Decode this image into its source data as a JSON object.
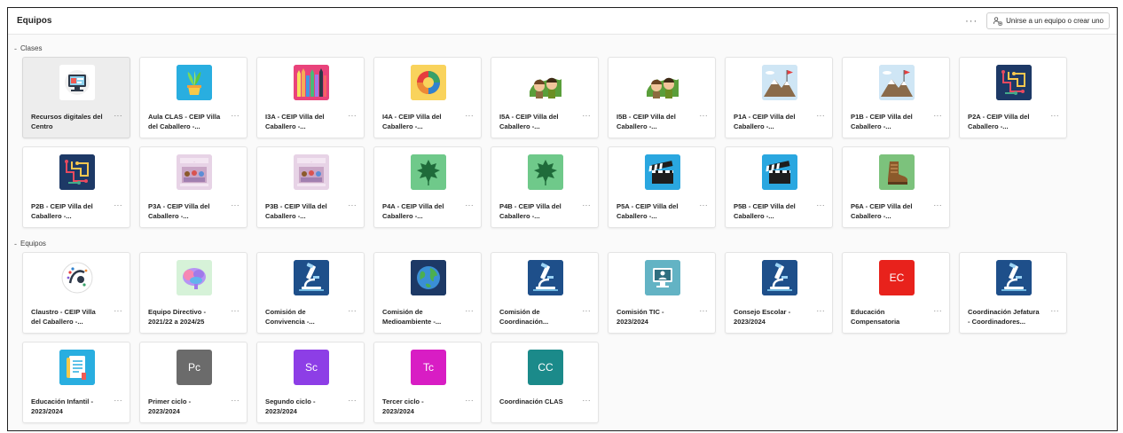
{
  "header": {
    "title": "Equipos",
    "more_label": "···",
    "join_button_label": "Unirse a un equipo o crear uno",
    "join_icon": "people-add-icon"
  },
  "sections": [
    {
      "title": "Clases",
      "caret": "-",
      "teams": [
        {
          "name_line1": "Recursos digitales del",
          "name_line2": "Centro",
          "more": "···",
          "icon": "computer-screen-icon",
          "bg": "#ffffff",
          "selected": true
        },
        {
          "name_line1": "Aula CLAS - CEIP Villa",
          "name_line2": "del Caballero -...",
          "more": "···",
          "icon": "potted-plant-icon",
          "bg": "#29aee0"
        },
        {
          "name_line1": "I3A - CEIP Villa del",
          "name_line2": "Caballero -...",
          "more": "···",
          "icon": "colored-pencils-icon",
          "bg": "#e9437b"
        },
        {
          "name_line1": "I4A - CEIP Villa del",
          "name_line2": "Caballero -...",
          "more": "···",
          "icon": "color-wheel-icon",
          "bg": "#f9d35c"
        },
        {
          "name_line1": "I5A - CEIP Villa del",
          "name_line2": "Caballero -...",
          "more": "···",
          "icon": "jungle-kids-icon",
          "bg": "#ffffff"
        },
        {
          "name_line1": "I5B - CEIP Villa del",
          "name_line2": "Caballero -...",
          "more": "···",
          "icon": "jungle-kids-icon",
          "bg": "#ffffff"
        },
        {
          "name_line1": "P1A - CEIP Villa del",
          "name_line2": "Caballero -...",
          "more": "···",
          "icon": "mountain-flag-icon",
          "bg": "#cfe6f5"
        },
        {
          "name_line1": "P1B - CEIP Villa del",
          "name_line2": "Caballero -...",
          "more": "···",
          "icon": "mountain-flag-icon",
          "bg": "#cfe6f5"
        },
        {
          "name_line1": "P2A - CEIP Villa del",
          "name_line2": "Caballero -...",
          "more": "···",
          "icon": "circuit-board-icon",
          "bg": "#1d3966"
        },
        {
          "name_line1": "P2B - CEIP Villa del",
          "name_line2": "Caballero -...",
          "more": "···",
          "icon": "circuit-board-icon",
          "bg": "#1d3966"
        },
        {
          "name_line1": "P3A - CEIP Villa del",
          "name_line2": "Caballero -...",
          "more": "···",
          "icon": "class-photo-icon",
          "bg": "#e7d3e6"
        },
        {
          "name_line1": "P3B - CEIP Villa del",
          "name_line2": "Caballero -...",
          "more": "···",
          "icon": "class-photo-icon",
          "bg": "#e7d3e6"
        },
        {
          "name_line1": "P4A - CEIP Villa del",
          "name_line2": "Caballero -...",
          "more": "···",
          "icon": "leaf-icon",
          "bg": "#6fc98a"
        },
        {
          "name_line1": "P4B - CEIP Villa del",
          "name_line2": "Caballero -...",
          "more": "···",
          "icon": "leaf-icon",
          "bg": "#6fc98a"
        },
        {
          "name_line1": "P5A - CEIP Villa del",
          "name_line2": "Caballero -...",
          "more": "···",
          "icon": "clapperboard-icon",
          "bg": "#2aa7e0"
        },
        {
          "name_line1": "P5B - CEIP Villa del",
          "name_line2": "Caballero -...",
          "more": "···",
          "icon": "clapperboard-icon",
          "bg": "#2aa7e0"
        },
        {
          "name_line1": "P6A - CEIP Villa del",
          "name_line2": "Caballero -...",
          "more": "···",
          "icon": "boot-icon",
          "bg": "#7cc27c"
        }
      ]
    },
    {
      "title": "Equipos",
      "caret": "-",
      "teams": [
        {
          "name_line1": "Claustro - CEIP Villa",
          "name_line2": "del Caballero -...",
          "more": "···",
          "icon": "logo-circle-icon",
          "bg": "#ffffff"
        },
        {
          "name_line1": "Equipo Directivo -",
          "name_line2": "2021/22 a 2024/25",
          "more": "···",
          "icon": "brain-icon",
          "bg": "#d6f2d8"
        },
        {
          "name_line1": "Comisión de",
          "name_line2": "Convivencia -...",
          "more": "···",
          "icon": "microscope-icon",
          "bg": "#1e4f8a"
        },
        {
          "name_line1": "Comisión de",
          "name_line2": "Medioambiente -...",
          "more": "···",
          "icon": "globe-icon",
          "bg": "#1d3966"
        },
        {
          "name_line1": "Comisión de",
          "name_line2": "Coordinación...",
          "more": "···",
          "icon": "microscope-icon",
          "bg": "#1e4f8a"
        },
        {
          "name_line1": "Comisión TIC -",
          "name_line2": "2023/2024",
          "more": "···",
          "icon": "monitor-icon",
          "bg": "#63b3c4"
        },
        {
          "name_line1": "Consejo Escolar -",
          "name_line2": "2023/2024",
          "more": "···",
          "icon": "microscope-icon",
          "bg": "#1e4f8a"
        },
        {
          "name_line1": "Educación",
          "name_line2": "Compensatoria",
          "more": "···",
          "icon": "letters-ec-icon",
          "bg": "#e8221c",
          "letters": "EC"
        },
        {
          "name_line1": "Coordinación Jefatura",
          "name_line2": "- Coordinadores...",
          "more": "···",
          "icon": "microscope-icon",
          "bg": "#1e4f8a"
        },
        {
          "name_line1": "Educación Infantil -",
          "name_line2": "2023/2024",
          "more": "···",
          "icon": "document-icon",
          "bg": "#29aee0"
        },
        {
          "name_line1": "Primer ciclo -",
          "name_line2": "2023/2024",
          "more": "···",
          "icon": "letters-pc-icon",
          "bg": "#6b6b6b",
          "letters": "Pc"
        },
        {
          "name_line1": "Segundo ciclo -",
          "name_line2": "2023/2024",
          "more": "···",
          "icon": "letters-sc-icon",
          "bg": "#8d3ee6",
          "letters": "Sc"
        },
        {
          "name_line1": "Tercer ciclo -",
          "name_line2": "2023/2024",
          "more": "···",
          "icon": "letters-tc-icon",
          "bg": "#d81dc4",
          "letters": "Tc"
        },
        {
          "name_line1": "Coordinación CLAS",
          "name_line2": "",
          "more": "···",
          "icon": "letters-cc-icon",
          "bg": "#1b8a8a",
          "letters": "CC"
        }
      ]
    }
  ]
}
